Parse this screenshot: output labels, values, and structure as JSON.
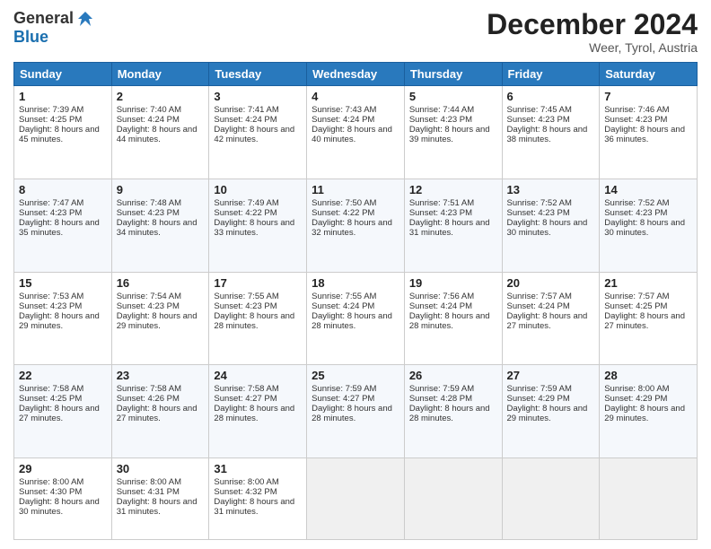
{
  "logo": {
    "general": "General",
    "blue": "Blue"
  },
  "title": "December 2024",
  "location": "Weer, Tyrol, Austria",
  "days_of_week": [
    "Sunday",
    "Monday",
    "Tuesday",
    "Wednesday",
    "Thursday",
    "Friday",
    "Saturday"
  ],
  "weeks": [
    [
      {
        "day": "1",
        "sunrise": "Sunrise: 7:39 AM",
        "sunset": "Sunset: 4:25 PM",
        "daylight": "Daylight: 8 hours and 45 minutes."
      },
      {
        "day": "2",
        "sunrise": "Sunrise: 7:40 AM",
        "sunset": "Sunset: 4:24 PM",
        "daylight": "Daylight: 8 hours and 44 minutes."
      },
      {
        "day": "3",
        "sunrise": "Sunrise: 7:41 AM",
        "sunset": "Sunset: 4:24 PM",
        "daylight": "Daylight: 8 hours and 42 minutes."
      },
      {
        "day": "4",
        "sunrise": "Sunrise: 7:43 AM",
        "sunset": "Sunset: 4:24 PM",
        "daylight": "Daylight: 8 hours and 40 minutes."
      },
      {
        "day": "5",
        "sunrise": "Sunrise: 7:44 AM",
        "sunset": "Sunset: 4:23 PM",
        "daylight": "Daylight: 8 hours and 39 minutes."
      },
      {
        "day": "6",
        "sunrise": "Sunrise: 7:45 AM",
        "sunset": "Sunset: 4:23 PM",
        "daylight": "Daylight: 8 hours and 38 minutes."
      },
      {
        "day": "7",
        "sunrise": "Sunrise: 7:46 AM",
        "sunset": "Sunset: 4:23 PM",
        "daylight": "Daylight: 8 hours and 36 minutes."
      }
    ],
    [
      {
        "day": "8",
        "sunrise": "Sunrise: 7:47 AM",
        "sunset": "Sunset: 4:23 PM",
        "daylight": "Daylight: 8 hours and 35 minutes."
      },
      {
        "day": "9",
        "sunrise": "Sunrise: 7:48 AM",
        "sunset": "Sunset: 4:23 PM",
        "daylight": "Daylight: 8 hours and 34 minutes."
      },
      {
        "day": "10",
        "sunrise": "Sunrise: 7:49 AM",
        "sunset": "Sunset: 4:22 PM",
        "daylight": "Daylight: 8 hours and 33 minutes."
      },
      {
        "day": "11",
        "sunrise": "Sunrise: 7:50 AM",
        "sunset": "Sunset: 4:22 PM",
        "daylight": "Daylight: 8 hours and 32 minutes."
      },
      {
        "day": "12",
        "sunrise": "Sunrise: 7:51 AM",
        "sunset": "Sunset: 4:23 PM",
        "daylight": "Daylight: 8 hours and 31 minutes."
      },
      {
        "day": "13",
        "sunrise": "Sunrise: 7:52 AM",
        "sunset": "Sunset: 4:23 PM",
        "daylight": "Daylight: 8 hours and 30 minutes."
      },
      {
        "day": "14",
        "sunrise": "Sunrise: 7:52 AM",
        "sunset": "Sunset: 4:23 PM",
        "daylight": "Daylight: 8 hours and 30 minutes."
      }
    ],
    [
      {
        "day": "15",
        "sunrise": "Sunrise: 7:53 AM",
        "sunset": "Sunset: 4:23 PM",
        "daylight": "Daylight: 8 hours and 29 minutes."
      },
      {
        "day": "16",
        "sunrise": "Sunrise: 7:54 AM",
        "sunset": "Sunset: 4:23 PM",
        "daylight": "Daylight: 8 hours and 29 minutes."
      },
      {
        "day": "17",
        "sunrise": "Sunrise: 7:55 AM",
        "sunset": "Sunset: 4:23 PM",
        "daylight": "Daylight: 8 hours and 28 minutes."
      },
      {
        "day": "18",
        "sunrise": "Sunrise: 7:55 AM",
        "sunset": "Sunset: 4:24 PM",
        "daylight": "Daylight: 8 hours and 28 minutes."
      },
      {
        "day": "19",
        "sunrise": "Sunrise: 7:56 AM",
        "sunset": "Sunset: 4:24 PM",
        "daylight": "Daylight: 8 hours and 28 minutes."
      },
      {
        "day": "20",
        "sunrise": "Sunrise: 7:57 AM",
        "sunset": "Sunset: 4:24 PM",
        "daylight": "Daylight: 8 hours and 27 minutes."
      },
      {
        "day": "21",
        "sunrise": "Sunrise: 7:57 AM",
        "sunset": "Sunset: 4:25 PM",
        "daylight": "Daylight: 8 hours and 27 minutes."
      }
    ],
    [
      {
        "day": "22",
        "sunrise": "Sunrise: 7:58 AM",
        "sunset": "Sunset: 4:25 PM",
        "daylight": "Daylight: 8 hours and 27 minutes."
      },
      {
        "day": "23",
        "sunrise": "Sunrise: 7:58 AM",
        "sunset": "Sunset: 4:26 PM",
        "daylight": "Daylight: 8 hours and 27 minutes."
      },
      {
        "day": "24",
        "sunrise": "Sunrise: 7:58 AM",
        "sunset": "Sunset: 4:27 PM",
        "daylight": "Daylight: 8 hours and 28 minutes."
      },
      {
        "day": "25",
        "sunrise": "Sunrise: 7:59 AM",
        "sunset": "Sunset: 4:27 PM",
        "daylight": "Daylight: 8 hours and 28 minutes."
      },
      {
        "day": "26",
        "sunrise": "Sunrise: 7:59 AM",
        "sunset": "Sunset: 4:28 PM",
        "daylight": "Daylight: 8 hours and 28 minutes."
      },
      {
        "day": "27",
        "sunrise": "Sunrise: 7:59 AM",
        "sunset": "Sunset: 4:29 PM",
        "daylight": "Daylight: 8 hours and 29 minutes."
      },
      {
        "day": "28",
        "sunrise": "Sunrise: 8:00 AM",
        "sunset": "Sunset: 4:29 PM",
        "daylight": "Daylight: 8 hours and 29 minutes."
      }
    ],
    [
      {
        "day": "29",
        "sunrise": "Sunrise: 8:00 AM",
        "sunset": "Sunset: 4:30 PM",
        "daylight": "Daylight: 8 hours and 30 minutes."
      },
      {
        "day": "30",
        "sunrise": "Sunrise: 8:00 AM",
        "sunset": "Sunset: 4:31 PM",
        "daylight": "Daylight: 8 hours and 31 minutes."
      },
      {
        "day": "31",
        "sunrise": "Sunrise: 8:00 AM",
        "sunset": "Sunset: 4:32 PM",
        "daylight": "Daylight: 8 hours and 31 minutes."
      },
      null,
      null,
      null,
      null
    ]
  ]
}
